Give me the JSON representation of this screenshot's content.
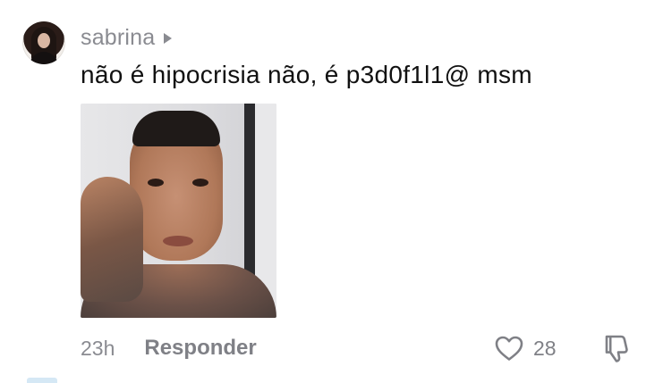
{
  "comment": {
    "username": "sabrina",
    "text": "não é hipocrisia não, é p3d0f1l1@ msm",
    "timestamp": "23h",
    "reply_label": "Responder",
    "like_count": "28",
    "icons": {
      "profile_chevron": "chevron-right-icon",
      "like": "heart-icon",
      "dislike": "thumbs-down-icon"
    },
    "colors": {
      "username": "#8a8b91",
      "text": "#111111",
      "meta": "#7f8086"
    }
  }
}
